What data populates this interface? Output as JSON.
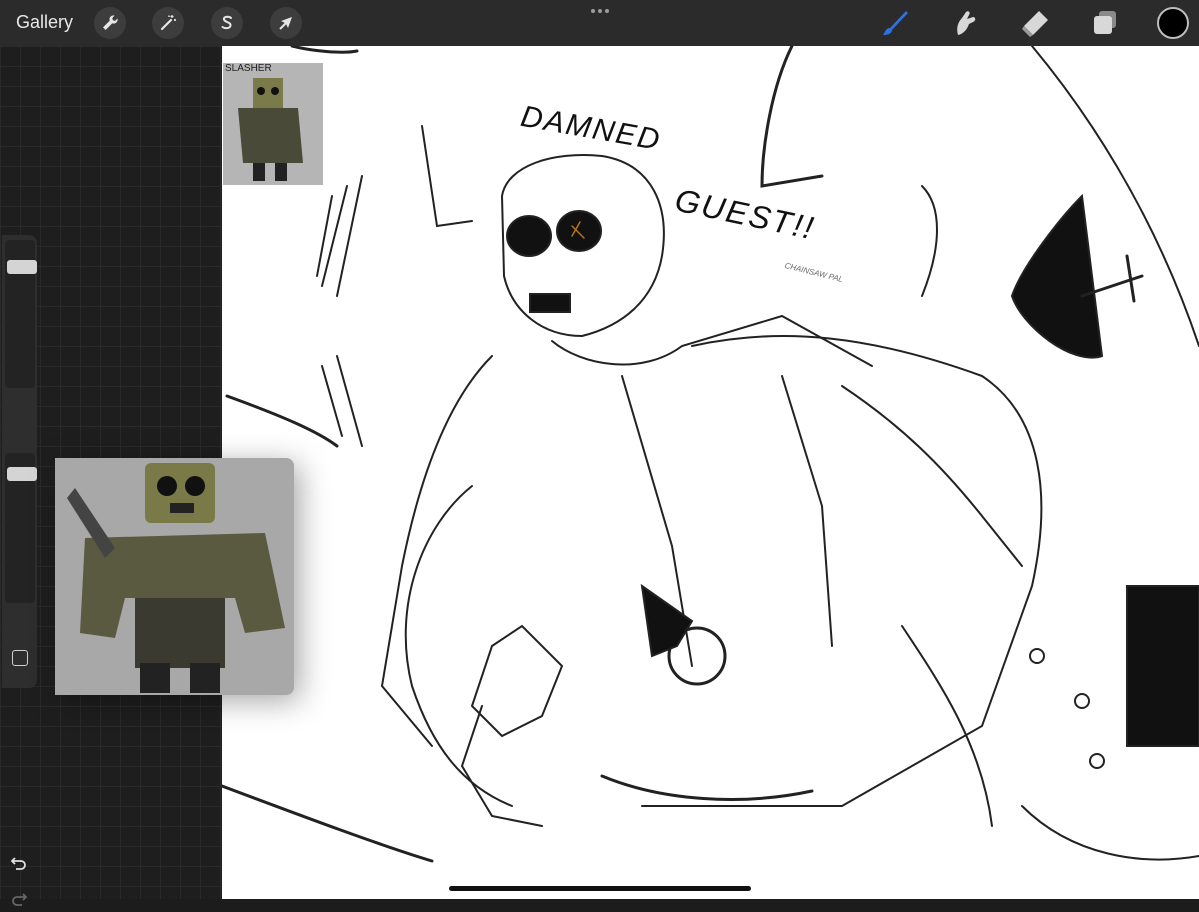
{
  "toolbar": {
    "gallery_label": "Gallery",
    "left_tools": [
      {
        "name": "actions",
        "icon": "wrench-icon"
      },
      {
        "name": "adjustments",
        "icon": "magic-wand-icon"
      },
      {
        "name": "selection",
        "icon": "selection-s-icon"
      },
      {
        "name": "transform",
        "icon": "arrow-cursor-icon"
      }
    ],
    "right_tools": [
      {
        "name": "brush",
        "icon": "brush-icon",
        "active": true
      },
      {
        "name": "smudge",
        "icon": "smudge-finger-icon"
      },
      {
        "name": "eraser",
        "icon": "eraser-icon"
      },
      {
        "name": "layers",
        "icon": "layers-icon"
      }
    ],
    "current_color": "#000000",
    "accent_color": "#2f6fe0"
  },
  "sidebar": {
    "brush_size_level": 0.85,
    "opacity_level": 0.9,
    "undo_icon": "undo-arrow-icon",
    "redo_icon": "redo-arrow-icon"
  },
  "canvas": {
    "thumbnail_reference_label": "SLASHER",
    "lettering_line1": "DAMNED",
    "lettering_line2": "GUEST!!",
    "small_label": "CHAINSAW PAL"
  }
}
